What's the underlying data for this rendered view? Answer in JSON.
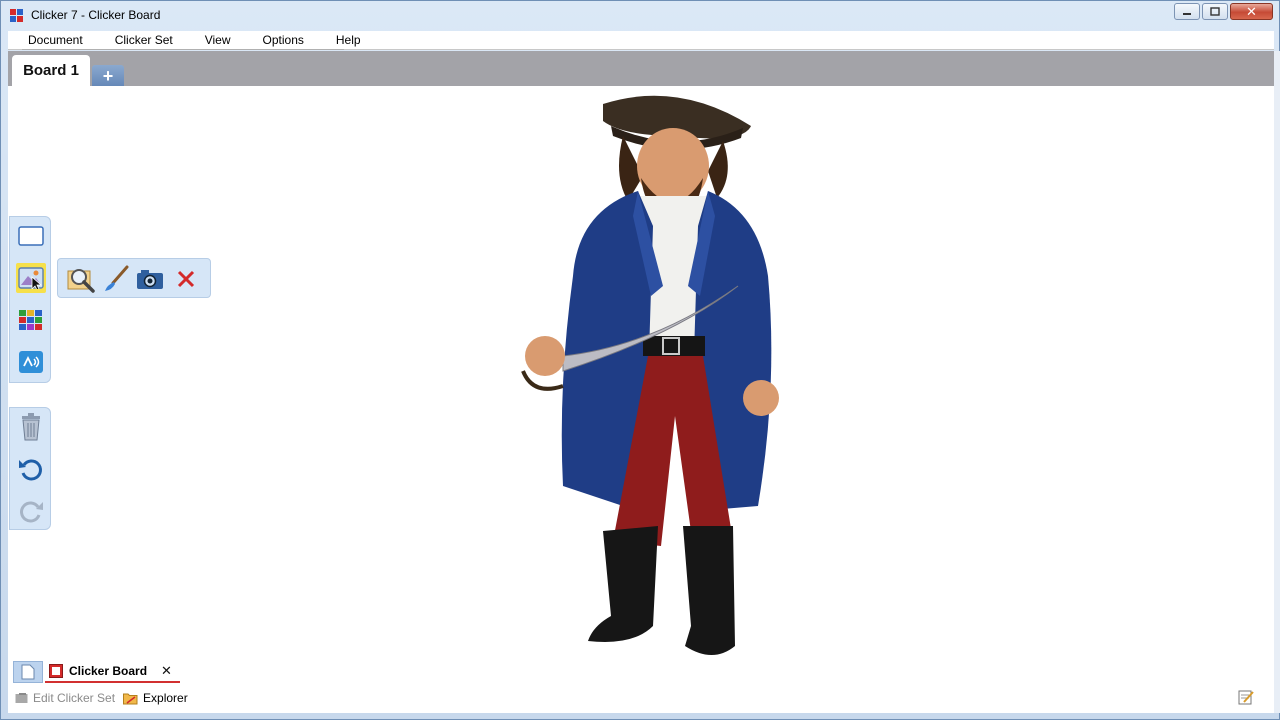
{
  "window": {
    "title": "Clicker 7 - Clicker Board",
    "minimize_label": "▭",
    "restore_label": "⧉",
    "close_label": "✕"
  },
  "menu": {
    "items": [
      "Document",
      "Clicker Set",
      "View",
      "Options",
      "Help"
    ]
  },
  "tabs": {
    "active_label": "Board 1",
    "add_label": "+"
  },
  "bottom": {
    "doc_tab_label": "Clicker Board",
    "doc_tab_close": "✕",
    "edit_clicker_set": "Edit Clicker Set",
    "explorer": "Explorer"
  },
  "colors": {
    "accent_yellow": "#f6e04a",
    "toolbar_bg": "#d6e6f7",
    "tab_strip": "#a3a3a8",
    "delete_red": "#d42a2a",
    "coat_blue": "#1f3d86",
    "pants_red": "#8f1c1c"
  },
  "icons": {
    "toolbar": [
      "blank-cell-icon",
      "picture-icon",
      "grid-icon",
      "speech-icon",
      "trash-icon",
      "undo-icon",
      "redo-icon"
    ],
    "popout": [
      "search-picture-icon",
      "paintbrush-icon",
      "camera-icon",
      "delete-icon"
    ]
  }
}
